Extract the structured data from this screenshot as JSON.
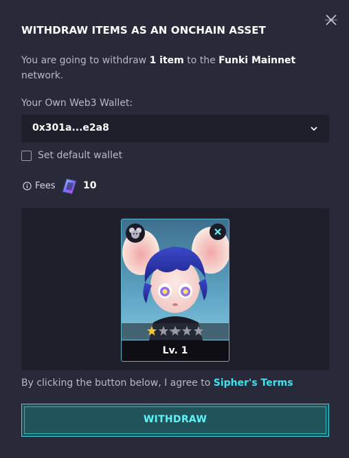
{
  "modal": {
    "title": "WITHDRAW ITEMS AS AN ONCHAIN ASSET",
    "description": {
      "prefix": "You are going to withdraw ",
      "item_count": "1 item",
      "middle": " to the ",
      "network": "Funki Mainnet",
      "suffix": " network."
    }
  },
  "wallet": {
    "label": "Your Own Web3 Wallet:",
    "selected": "0x301a...e2a8"
  },
  "default_wallet": {
    "label": "Set default wallet",
    "checked": false
  },
  "fees": {
    "label": "Fees",
    "amount": "10"
  },
  "item_card": {
    "level": "Lv. 1",
    "stars_filled": 1,
    "stars_total": 5
  },
  "terms": {
    "prefix": "By clicking the button below, I agree to ",
    "link": "Sipher's Terms"
  },
  "withdraw_button": {
    "label": "WITHDRAW"
  },
  "colors": {
    "background": "#282939",
    "panel": "#1e1f2b",
    "accent": "#3fe3f0",
    "button_bg": "#1f4f57"
  }
}
